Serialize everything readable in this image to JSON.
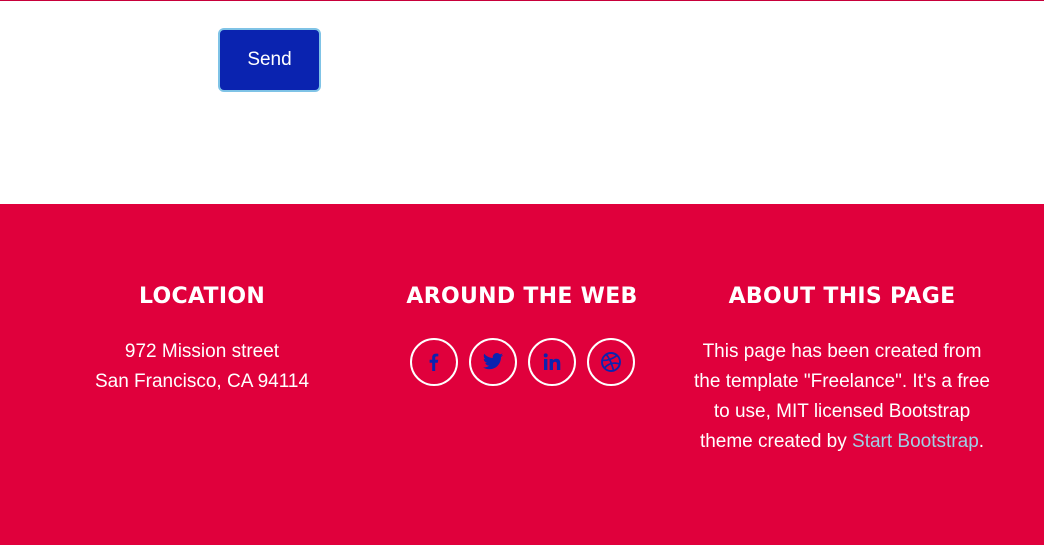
{
  "form": {
    "send_label": "Send"
  },
  "footer": {
    "location": {
      "heading": "LOCATION",
      "address_line1": "972 Mission street",
      "address_line2": "San Francisco, CA 94114"
    },
    "web": {
      "heading": "AROUND THE WEB",
      "social": [
        {
          "name": "facebook",
          "icon": "facebook-icon"
        },
        {
          "name": "twitter",
          "icon": "twitter-icon"
        },
        {
          "name": "linkedin",
          "icon": "linkedin-icon"
        },
        {
          "name": "dribbble",
          "icon": "dribbble-icon"
        }
      ]
    },
    "about": {
      "heading": "ABOUT THIS PAGE",
      "text_before": "This page has been created from the template \"Freelance\". It's a free to use, MIT licensed Bootstrap theme created by ",
      "link_text": "Start Bootstrap",
      "text_after": "."
    }
  },
  "colors": {
    "footer_bg": "#e0003c",
    "button_bg": "#0a23b0",
    "icon_color": "#0a23b0",
    "link_color": "#9fd0e6"
  }
}
